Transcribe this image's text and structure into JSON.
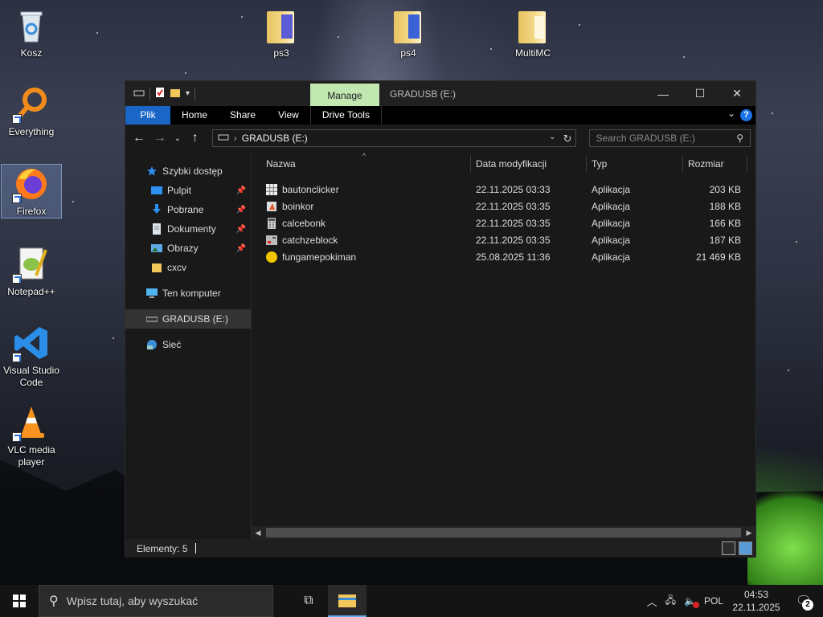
{
  "desktop": {
    "icons": [
      {
        "label": "Kosz"
      },
      {
        "label": "Everything"
      },
      {
        "label": "Firefox"
      },
      {
        "label": "Notepad++"
      },
      {
        "label": "Visual Studio Code"
      },
      {
        "label": "VLC media player"
      },
      {
        "label": "ps3"
      },
      {
        "label": "ps4"
      },
      {
        "label": "MultiMC"
      }
    ]
  },
  "window": {
    "context_tab": "Manage",
    "title": "GRADUSB (E:)",
    "ribbon_tabs": [
      "Plik",
      "Home",
      "Share",
      "View",
      "Drive Tools"
    ],
    "help_glyph": "?",
    "address": "GRADUSB (E:)",
    "search_placeholder": "Search GRADUSB (E:)",
    "sidebar": {
      "items": [
        {
          "label": "Szybki dostęp",
          "icon": "star-icon"
        },
        {
          "label": "Pulpit",
          "icon": "desktop-folder-icon",
          "pinned": true
        },
        {
          "label": "Pobrane",
          "icon": "download-icon",
          "pinned": true
        },
        {
          "label": "Dokumenty",
          "icon": "documents-icon",
          "pinned": true
        },
        {
          "label": "Obrazy",
          "icon": "pictures-icon",
          "pinned": true
        },
        {
          "label": "cxcv",
          "icon": "folder-icon"
        },
        {
          "label": "Ten komputer",
          "icon": "computer-icon"
        },
        {
          "label": "GRADUSB (E:)",
          "icon": "drive-icon",
          "selected": true
        },
        {
          "label": "Sieć",
          "icon": "network-icon"
        }
      ]
    },
    "columns": [
      "Nazwa",
      "Data modyfikacji",
      "Typ",
      "Rozmiar"
    ],
    "files": [
      {
        "name": "bautonclicker",
        "date": "22.11.2025 03:33",
        "type": "Aplikacja",
        "size": "203 KB",
        "icon": "grid-app-icon"
      },
      {
        "name": "boinkor",
        "date": "22.11.2025 03:35",
        "type": "Aplikacja",
        "size": "188 KB",
        "icon": "app-icon"
      },
      {
        "name": "calcebonk",
        "date": "22.11.2025 03:35",
        "type": "Aplikacja",
        "size": "166 KB",
        "icon": "calculator-icon"
      },
      {
        "name": "catchzeblock",
        "date": "22.11.2025 03:35",
        "type": "Aplikacja",
        "size": "187 KB",
        "icon": "block-app-icon"
      },
      {
        "name": "fungamepokiman",
        "date": "25.08.2025 11:36",
        "type": "Aplikacja",
        "size": "21 469 KB",
        "icon": "yellow-circle-icon"
      }
    ],
    "status": "Elementy: 5"
  },
  "taskbar": {
    "search_placeholder": "Wpisz tutaj, aby wyszukać",
    "language": "POL",
    "time": "04:53",
    "date": "22.11.2025",
    "notifications": "2"
  },
  "colors": {
    "file_tab": "#1a66c6",
    "manage_tab": "#c2e8b2",
    "window_bg": "#191919",
    "taskbar_bg": "#141414"
  }
}
